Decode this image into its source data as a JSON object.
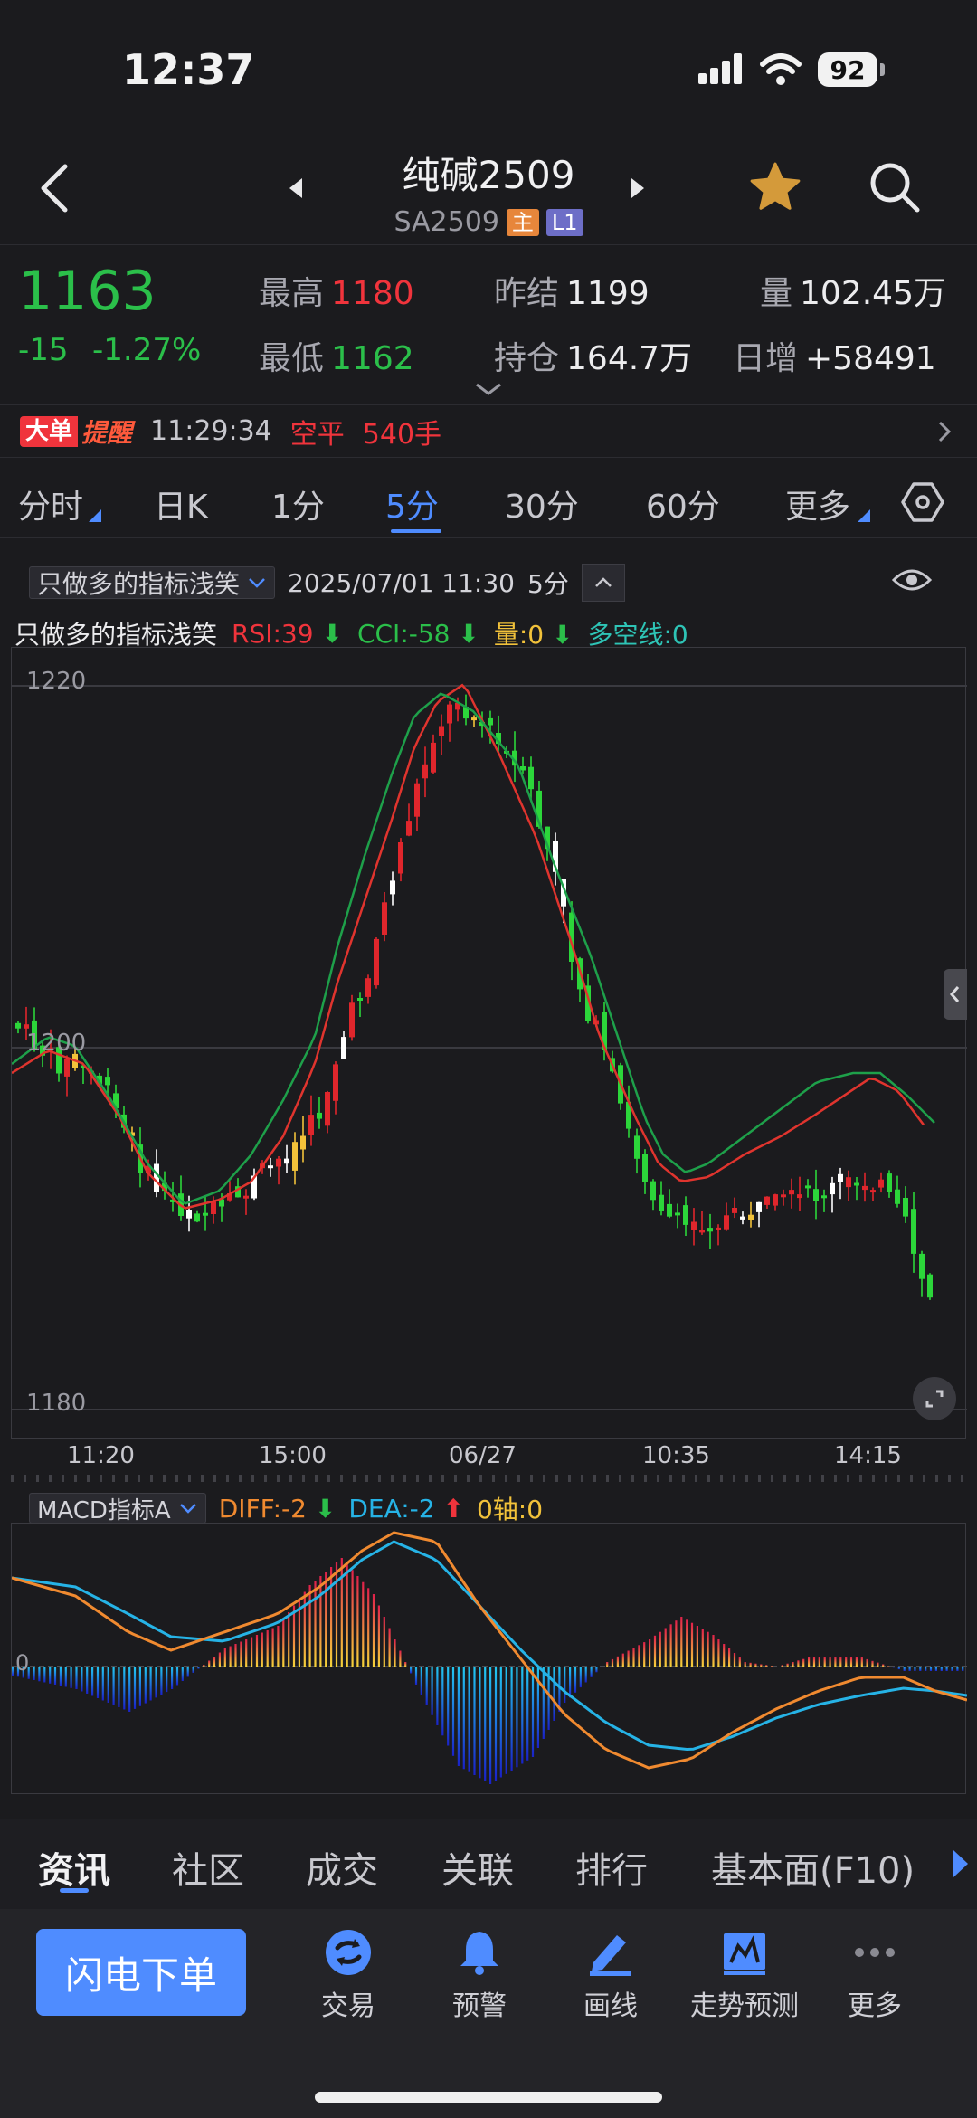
{
  "status_bar": {
    "time": "12:37",
    "battery": "92"
  },
  "header": {
    "title": "纯碱2509",
    "code": "SA2509",
    "tag_main": "主",
    "tag_level": "L1"
  },
  "quote": {
    "price": "1163",
    "change": "-15",
    "change_pct": "-1.27%",
    "high_label": "最高",
    "high": "1180",
    "low_label": "最低",
    "low": "1162",
    "prev_settle_label": "昨结",
    "prev_settle": "1199",
    "open_interest_label": "持仓",
    "open_interest": "164.7万",
    "volume_label": "量",
    "volume": "102.45万",
    "daily_inc_label": "日增",
    "daily_inc": "+58491"
  },
  "alert": {
    "badge_a": "大单",
    "badge_b": "提醒",
    "time": "11:29:34",
    "action": "空平",
    "qty": "540手"
  },
  "period_tabs": [
    "分时",
    "日K",
    "1分",
    "5分",
    "30分",
    "60分",
    "更多"
  ],
  "active_period": "5分",
  "toolbar": {
    "indicator_name": "只做多的指标浅笑",
    "datetime": "2025/07/01 11:30",
    "period": "5分"
  },
  "indicator_line": {
    "name": "只做多的指标浅笑",
    "rsi": "RSI:39",
    "cci": "CCI:-58",
    "vol": "量:0",
    "trend": "多空线:0"
  },
  "main_chart_y_labels": [
    "1220",
    "1200",
    "1180"
  ],
  "x_axis_labels": [
    "11:20",
    "15:00",
    "06/27",
    "10:35",
    "14:15"
  ],
  "macd": {
    "selector": "MACD指标A",
    "diff": "DIFF:-2",
    "dea": "DEA:-2",
    "zero": "0轴:0",
    "zero_tick": "0"
  },
  "info_tabs": [
    "资讯",
    "社区",
    "成交",
    "关联",
    "排行",
    "基本面(F10)"
  ],
  "bottom_bar": {
    "order_button": "闪电下单",
    "tools": [
      "交易",
      "预警",
      "画线",
      "走势预测",
      "更多"
    ]
  },
  "colors": {
    "up": "#f0343c",
    "down": "#2bbf4a",
    "accent": "#4f8cff",
    "diff_line": "#f08a30",
    "dea_line": "#26b3e6"
  }
}
